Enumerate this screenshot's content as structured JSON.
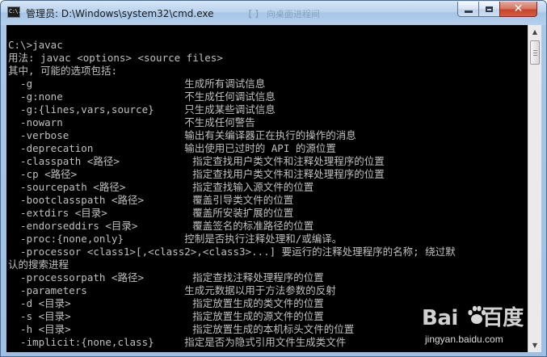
{
  "window": {
    "title": "管理员: D:\\Windows\\system32\\cmd.exe",
    "ghost_title": "【 】 向桌面进程间"
  },
  "titlebar_icons": {
    "app": "command-prompt-icon",
    "app_icon_text": "C:\\."
  },
  "controls": {
    "minimize": "minimize-icon",
    "maximize": "maximize-icon",
    "close": "close-icon",
    "close_glyph": "✕"
  },
  "console": {
    "lines": [
      "",
      "C:\\>javac",
      "用法: javac <options> <source files>",
      "其中, 可能的选项包括:",
      "  -g                         生成所有调试信息",
      "  -g:none                    不生成任何调试信息",
      "  -g:{lines,vars,source}     只生成某些调试信息",
      "  -nowarn                    不生成任何警告",
      "  -verbose                   输出有关编译器正在执行的操作的消息",
      "  -deprecation               输出使用已过时的 API 的源位置",
      "  -classpath <路径>            指定查找用户类文件和注释处理程序的位置",
      "  -cp <路径>                   指定查找用户类文件和注释处理程序的位置",
      "  -sourcepath <路径>           指定查找输入源文件的位置",
      "  -bootclasspath <路径>        覆盖引导类文件的位置",
      "  -extdirs <目录>              覆盖所安装扩展的位置",
      "  -endorseddirs <目录>         覆盖签名的标准路径的位置",
      "  -proc:{none,only}          控制是否执行注释处理和/或编译。",
      "  -processor <class1>[,<class2>,<class3>...] 要运行的注释处理程序的名称; 绕过默",
      "认的搜索进程",
      "  -processorpath <路径>        指定查找注释处理程序的位置",
      "  -parameters                生成元数据以用于方法参数的反射",
      "  -d <目录>                    指定放置生成的类文件的位置",
      "  -s <目录>                    指定放置生成的源文件的位置",
      "  -h <目录>                    指定放置生成的本机标头文件的位置",
      "  -implicit:{none,class}     指定是否为隐式引用文件生成类文件"
    ],
    "text_color": "#c0c0c0",
    "background": "#000000"
  },
  "scrollbar": {
    "up": "scroll-up-arrow-icon",
    "down": "scroll-down-arrow-icon",
    "up_glyph": "▲",
    "down_glyph": "▼"
  },
  "watermark": {
    "logo_left": "Bai",
    "logo_right": "百度",
    "logo_icon": "paw-icon",
    "subtitle": "jingyan.baidu.com"
  }
}
